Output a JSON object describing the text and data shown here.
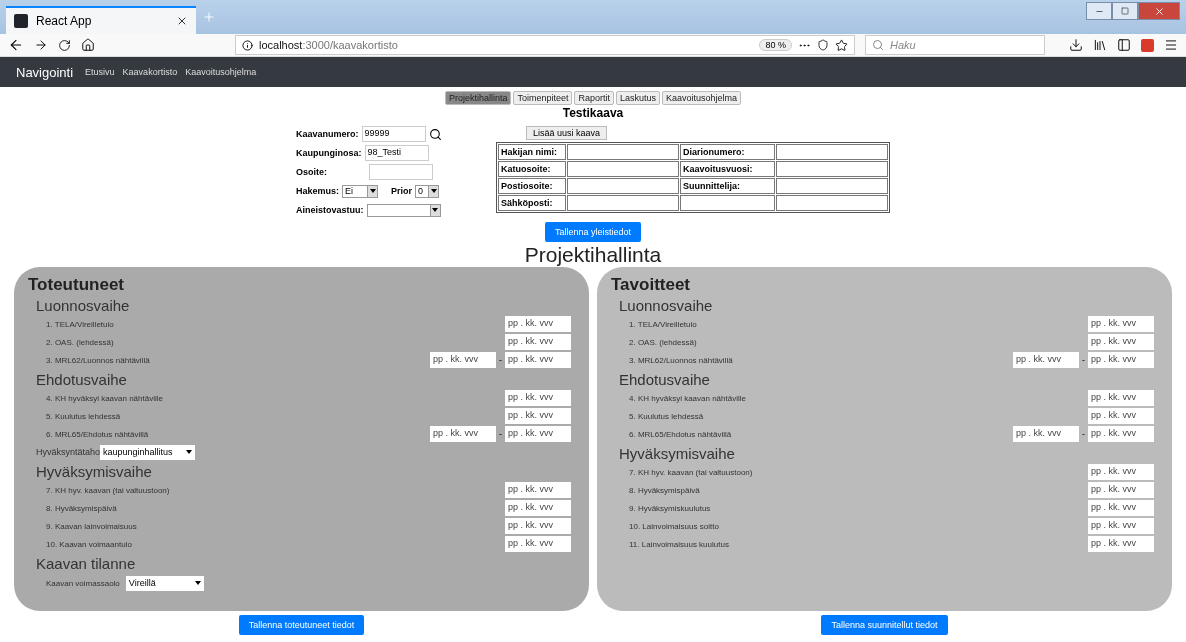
{
  "browser": {
    "tab_title": "React App",
    "url_host": "localhost",
    "url_path": ":3000/kaavakortisto",
    "zoom": "80 %",
    "search_placeholder": "Haku"
  },
  "nav": {
    "brand": "Navigointi",
    "links": [
      "Etusivu",
      "Kaavakortisto",
      "Kaavoitusohjelma"
    ]
  },
  "tabs": [
    {
      "label": "Projektihallinta",
      "selected": true
    },
    {
      "label": "Toimenpiteet",
      "selected": false
    },
    {
      "label": "Raportit",
      "selected": false
    },
    {
      "label": "Laskutus",
      "selected": false
    },
    {
      "label": "Kaavoitusohjelma",
      "selected": false
    }
  ],
  "title": "Testikaava",
  "form": {
    "kaavanumero": {
      "label": "Kaavanumero:",
      "value": "99999"
    },
    "kaupunginosa": {
      "label": "Kaupunginosa:",
      "value": "98_Testi"
    },
    "osoite": {
      "label": "Osoite:"
    },
    "hakemus": {
      "label": "Hakemus:",
      "value": "Ei"
    },
    "prior": {
      "label": "Prior",
      "value": "0"
    },
    "aineistovastuu": {
      "label": "Aineistovastuu:"
    }
  },
  "add_button": "Lisää uusi kaava",
  "info_table": [
    {
      "label_1": "Hakijan nimi:",
      "label_2": "Diarionumero:"
    },
    {
      "label_1": "Katuosoite:",
      "label_2": "Kaavoitusvuosi:"
    },
    {
      "label_1": "Postiosoite:",
      "label_2": "Suunnittelija:"
    },
    {
      "label_1": "Sähköposti:"
    }
  ],
  "save_general_button": "Tallenna yleistiedot",
  "section_title": "Projektihallinta",
  "panels": [
    {
      "title": "Toteutuneet",
      "button": "Tallenna toteutuneet tiedot",
      "sections": [
        {
          "heading": "Luonnosvaihe",
          "items": [
            {
              "kind": "date",
              "label": "1. TELA/Vireilletulo",
              "placeholder": "pp . kk. vvv"
            },
            {
              "kind": "date",
              "label": "2. OAS. (lehdessä)",
              "placeholder": "pp . kk. vvv"
            },
            {
              "kind": "range",
              "label": "3. MRL62/Luonnos nähtävillä",
              "placeholder_from": "pp . kk. vvv",
              "separator": "-",
              "placeholder": "pp . kk. vvv"
            }
          ]
        },
        {
          "heading": "Ehdotusvaihe",
          "items": [
            {
              "kind": "date",
              "label": "4. KH hyväksyi kaavan nähtäville",
              "placeholder": "pp . kk. vvv"
            },
            {
              "kind": "date",
              "label": "5. Kuulutus lehdessä",
              "placeholder": "pp . kk. vvv"
            },
            {
              "kind": "range",
              "label": "6. MRL65/Ehdotus nähtävillä",
              "placeholder_from": "pp . kk. vvv",
              "separator": "-",
              "placeholder": "pp . kk. vvv"
            },
            {
              "kind": "outer_select",
              "label": "Hyväksyntätaho",
              "value": "kaupunginhallitus"
            }
          ]
        },
        {
          "heading": "Hyväksymisvaihe",
          "items": [
            {
              "kind": "date",
              "label": "7. KH hyv. kaavan (tai valtuustoon)",
              "placeholder": "pp . kk. vvv"
            },
            {
              "kind": "date",
              "label": "8. Hyväksymispäivä",
              "placeholder": "pp . kk. vvv"
            },
            {
              "kind": "date",
              "label": "9. Kaavan lainvoimaisuus",
              "placeholder": "pp . kk. vvv"
            },
            {
              "kind": "date",
              "label": "10. Kaavan voimaantulo",
              "placeholder": "pp . kk. vvv"
            }
          ]
        },
        {
          "heading": "Kaavan tilanne",
          "items": [
            {
              "kind": "select",
              "label": "Kaavan voimassaolo",
              "value": "Vireillä"
            }
          ]
        }
      ]
    },
    {
      "title": "Tavoitteet",
      "button": "Tallenna suunnitellut tiedot",
      "sections": [
        {
          "heading": "Luonnosvaihe",
          "items": [
            {
              "kind": "date",
              "label": "1. TELA/Vireilletulo",
              "placeholder": "pp . kk. vvv"
            },
            {
              "kind": "date",
              "label": "2. OAS. (lehdessä)",
              "placeholder": "pp . kk. vvv"
            },
            {
              "kind": "range",
              "label": "3. MRL62/Luonnos nähtävillä",
              "placeholder_from": "pp . kk. vvv",
              "separator": "-",
              "placeholder": "pp . kk. vvv"
            }
          ]
        },
        {
          "heading": "Ehdotusvaihe",
          "items": [
            {
              "kind": "date",
              "label": "4. KH hyväksyi kaavan nähtäville",
              "placeholder": "pp . kk. vvv"
            },
            {
              "kind": "date",
              "label": "5. Kuulutus lehdessä",
              "placeholder": "pp . kk. vvv"
            },
            {
              "kind": "range",
              "label": "6. MRL65/Ehdotus nähtävillä",
              "placeholder_from": "pp . kk. vvv",
              "separator": "-",
              "placeholder": "pp . kk. vvv"
            }
          ]
        },
        {
          "heading": "Hyväksymisvaihe",
          "items": [
            {
              "kind": "date",
              "label": "7. KH hyv. kaavan (tai valtuustoon)",
              "placeholder": "pp . kk. vvv"
            },
            {
              "kind": "date",
              "label": "8. Hyväksymispäivä",
              "placeholder": "pp . kk. vvv"
            },
            {
              "kind": "date",
              "label": "9. Hyväksymiskuulutus",
              "placeholder": "pp . kk. vvv"
            },
            {
              "kind": "date",
              "label": "10. Lainvoimaisuus soitto",
              "placeholder": "pp . kk. vvv"
            },
            {
              "kind": "date",
              "label": "11. Lainvoimaisuus kuulutus",
              "placeholder": "pp . kk. vvv"
            }
          ]
        }
      ]
    }
  ]
}
